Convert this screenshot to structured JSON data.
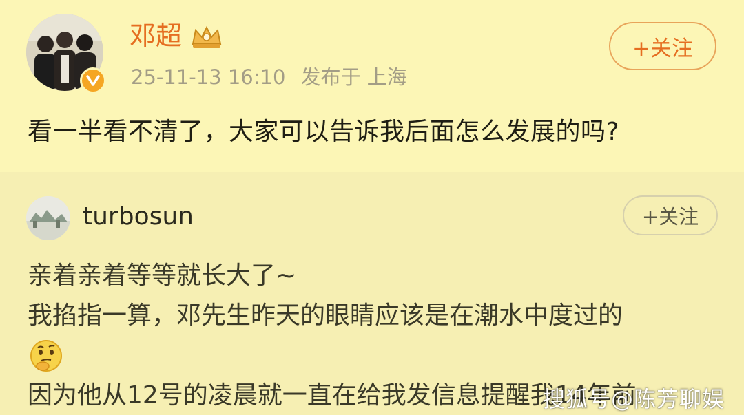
{
  "post": {
    "author_name": "邓超",
    "timestamp": "25-11-13 16:10",
    "location": "发布于 上海",
    "follow_label": "+关注",
    "text": "看一半看不清了，大家可以告诉我后面怎么发展的吗?",
    "icons": {
      "avatar": "group-photo-avatar",
      "crown": "crown-icon",
      "verified": "verified-badge-icon"
    }
  },
  "comment": {
    "username": "turbosun",
    "follow_label": "+关注",
    "lines": [
      "亲着亲着等等就长大了~",
      "我掐指一算，邓先生昨天的眼睛应该是在潮水中度过的",
      "因为他从12号的凌晨就一直在给我发信息提醒我14年前"
    ],
    "emoji": "thinking-face-emoji"
  },
  "watermark": "搜狐号@陈芳聊娱",
  "colors": {
    "background": "#fcf6b6",
    "comment_background": "#f6efb3",
    "author_name": "#e56e21",
    "verified_badge": "#f5a623",
    "meta_text": "#a39d86"
  }
}
